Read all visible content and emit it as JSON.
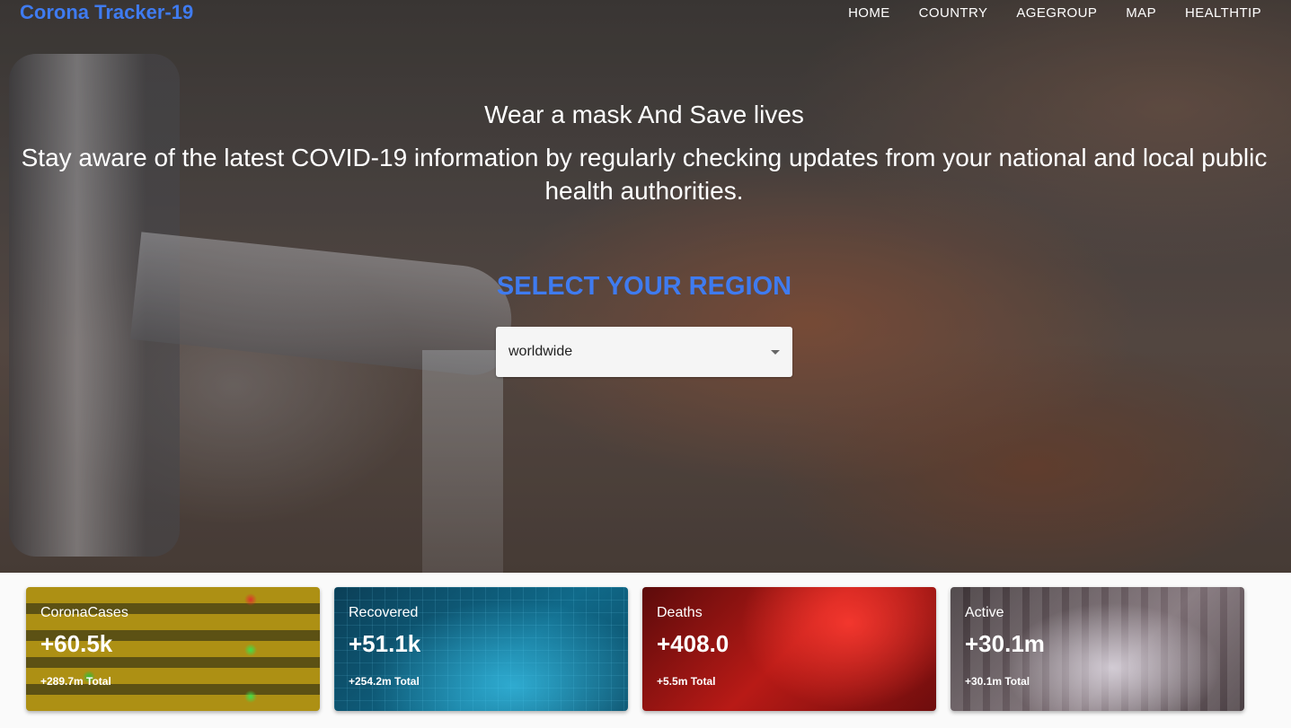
{
  "brand": "Corona Tracker-19",
  "nav": [
    "HOME",
    "COUNTRY",
    "AGEGROUP",
    "MAP",
    "HEALTHTIP"
  ],
  "hero": {
    "headline": "Wear a mask And Save lives",
    "subline": "Stay aware of the latest COVID-19 information by regularly checking updates from your national and local public health authorities.",
    "region_title": "SELECT YOUR REGION",
    "region_value": "worldwide"
  },
  "cards": [
    {
      "label": "CoronaCases",
      "value": "+60.5k",
      "total": "+289.7m Total"
    },
    {
      "label": "Recovered",
      "value": "+51.1k",
      "total": "+254.2m Total"
    },
    {
      "label": "Deaths",
      "value": "+408.0",
      "total": "+5.5m Total"
    },
    {
      "label": "Active",
      "value": "+30.1m",
      "total": "+30.1m Total"
    }
  ],
  "colors": {
    "accent": "#3f7bf0"
  },
  "icons": {
    "select_caret": "chevron-down-icon"
  }
}
